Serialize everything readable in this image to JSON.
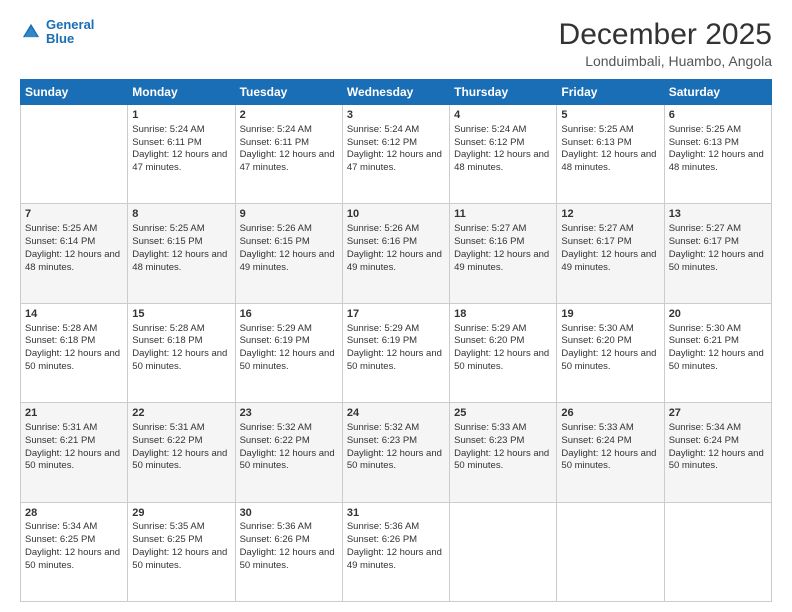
{
  "header": {
    "logo_line1": "General",
    "logo_line2": "Blue",
    "title": "December 2025",
    "subtitle": "Londuimbali, Huambo, Angola"
  },
  "days_of_week": [
    "Sunday",
    "Monday",
    "Tuesday",
    "Wednesday",
    "Thursday",
    "Friday",
    "Saturday"
  ],
  "weeks": [
    [
      {
        "day": "",
        "empty": true
      },
      {
        "day": "1",
        "sunrise": "Sunrise: 5:24 AM",
        "sunset": "Sunset: 6:11 PM",
        "daylight": "Daylight: 12 hours and 47 minutes."
      },
      {
        "day": "2",
        "sunrise": "Sunrise: 5:24 AM",
        "sunset": "Sunset: 6:11 PM",
        "daylight": "Daylight: 12 hours and 47 minutes."
      },
      {
        "day": "3",
        "sunrise": "Sunrise: 5:24 AM",
        "sunset": "Sunset: 6:12 PM",
        "daylight": "Daylight: 12 hours and 47 minutes."
      },
      {
        "day": "4",
        "sunrise": "Sunrise: 5:24 AM",
        "sunset": "Sunset: 6:12 PM",
        "daylight": "Daylight: 12 hours and 48 minutes."
      },
      {
        "day": "5",
        "sunrise": "Sunrise: 5:25 AM",
        "sunset": "Sunset: 6:13 PM",
        "daylight": "Daylight: 12 hours and 48 minutes."
      },
      {
        "day": "6",
        "sunrise": "Sunrise: 5:25 AM",
        "sunset": "Sunset: 6:13 PM",
        "daylight": "Daylight: 12 hours and 48 minutes."
      }
    ],
    [
      {
        "day": "7",
        "sunrise": "Sunrise: 5:25 AM",
        "sunset": "Sunset: 6:14 PM",
        "daylight": "Daylight: 12 hours and 48 minutes."
      },
      {
        "day": "8",
        "sunrise": "Sunrise: 5:25 AM",
        "sunset": "Sunset: 6:15 PM",
        "daylight": "Daylight: 12 hours and 48 minutes."
      },
      {
        "day": "9",
        "sunrise": "Sunrise: 5:26 AM",
        "sunset": "Sunset: 6:15 PM",
        "daylight": "Daylight: 12 hours and 49 minutes."
      },
      {
        "day": "10",
        "sunrise": "Sunrise: 5:26 AM",
        "sunset": "Sunset: 6:16 PM",
        "daylight": "Daylight: 12 hours and 49 minutes."
      },
      {
        "day": "11",
        "sunrise": "Sunrise: 5:27 AM",
        "sunset": "Sunset: 6:16 PM",
        "daylight": "Daylight: 12 hours and 49 minutes."
      },
      {
        "day": "12",
        "sunrise": "Sunrise: 5:27 AM",
        "sunset": "Sunset: 6:17 PM",
        "daylight": "Daylight: 12 hours and 49 minutes."
      },
      {
        "day": "13",
        "sunrise": "Sunrise: 5:27 AM",
        "sunset": "Sunset: 6:17 PM",
        "daylight": "Daylight: 12 hours and 50 minutes."
      }
    ],
    [
      {
        "day": "14",
        "sunrise": "Sunrise: 5:28 AM",
        "sunset": "Sunset: 6:18 PM",
        "daylight": "Daylight: 12 hours and 50 minutes."
      },
      {
        "day": "15",
        "sunrise": "Sunrise: 5:28 AM",
        "sunset": "Sunset: 6:18 PM",
        "daylight": "Daylight: 12 hours and 50 minutes."
      },
      {
        "day": "16",
        "sunrise": "Sunrise: 5:29 AM",
        "sunset": "Sunset: 6:19 PM",
        "daylight": "Daylight: 12 hours and 50 minutes."
      },
      {
        "day": "17",
        "sunrise": "Sunrise: 5:29 AM",
        "sunset": "Sunset: 6:19 PM",
        "daylight": "Daylight: 12 hours and 50 minutes."
      },
      {
        "day": "18",
        "sunrise": "Sunrise: 5:29 AM",
        "sunset": "Sunset: 6:20 PM",
        "daylight": "Daylight: 12 hours and 50 minutes."
      },
      {
        "day": "19",
        "sunrise": "Sunrise: 5:30 AM",
        "sunset": "Sunset: 6:20 PM",
        "daylight": "Daylight: 12 hours and 50 minutes."
      },
      {
        "day": "20",
        "sunrise": "Sunrise: 5:30 AM",
        "sunset": "Sunset: 6:21 PM",
        "daylight": "Daylight: 12 hours and 50 minutes."
      }
    ],
    [
      {
        "day": "21",
        "sunrise": "Sunrise: 5:31 AM",
        "sunset": "Sunset: 6:21 PM",
        "daylight": "Daylight: 12 hours and 50 minutes."
      },
      {
        "day": "22",
        "sunrise": "Sunrise: 5:31 AM",
        "sunset": "Sunset: 6:22 PM",
        "daylight": "Daylight: 12 hours and 50 minutes."
      },
      {
        "day": "23",
        "sunrise": "Sunrise: 5:32 AM",
        "sunset": "Sunset: 6:22 PM",
        "daylight": "Daylight: 12 hours and 50 minutes."
      },
      {
        "day": "24",
        "sunrise": "Sunrise: 5:32 AM",
        "sunset": "Sunset: 6:23 PM",
        "daylight": "Daylight: 12 hours and 50 minutes."
      },
      {
        "day": "25",
        "sunrise": "Sunrise: 5:33 AM",
        "sunset": "Sunset: 6:23 PM",
        "daylight": "Daylight: 12 hours and 50 minutes."
      },
      {
        "day": "26",
        "sunrise": "Sunrise: 5:33 AM",
        "sunset": "Sunset: 6:24 PM",
        "daylight": "Daylight: 12 hours and 50 minutes."
      },
      {
        "day": "27",
        "sunrise": "Sunrise: 5:34 AM",
        "sunset": "Sunset: 6:24 PM",
        "daylight": "Daylight: 12 hours and 50 minutes."
      }
    ],
    [
      {
        "day": "28",
        "sunrise": "Sunrise: 5:34 AM",
        "sunset": "Sunset: 6:25 PM",
        "daylight": "Daylight: 12 hours and 50 minutes."
      },
      {
        "day": "29",
        "sunrise": "Sunrise: 5:35 AM",
        "sunset": "Sunset: 6:25 PM",
        "daylight": "Daylight: 12 hours and 50 minutes."
      },
      {
        "day": "30",
        "sunrise": "Sunrise: 5:36 AM",
        "sunset": "Sunset: 6:26 PM",
        "daylight": "Daylight: 12 hours and 50 minutes."
      },
      {
        "day": "31",
        "sunrise": "Sunrise: 5:36 AM",
        "sunset": "Sunset: 6:26 PM",
        "daylight": "Daylight: 12 hours and 49 minutes."
      },
      {
        "day": "",
        "empty": true
      },
      {
        "day": "",
        "empty": true
      },
      {
        "day": "",
        "empty": true
      }
    ]
  ]
}
